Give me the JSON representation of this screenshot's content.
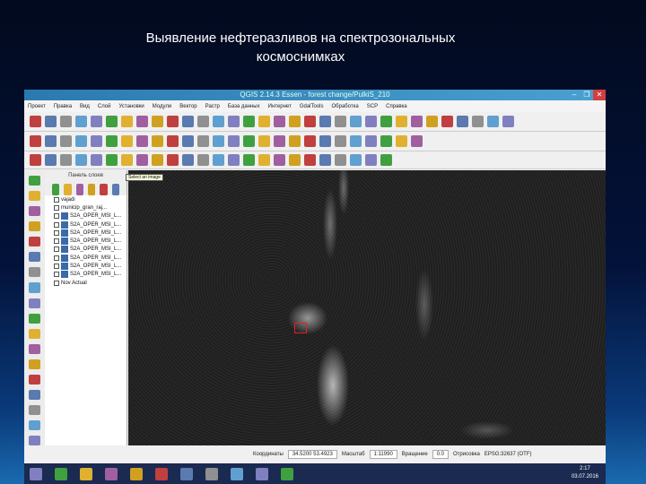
{
  "slide": {
    "title_line1": "Выявление нефтеразливов на спектрозональных",
    "title_line2": "космоснимках"
  },
  "window": {
    "title": "QGIS 2.14.3 Essen - forest change/PulkiS_210",
    "controls": [
      "–",
      "❐",
      "✕"
    ]
  },
  "menu": [
    "Проект",
    "Правка",
    "Вид",
    "Слой",
    "Установки",
    "Модули",
    "Вектор",
    "Растр",
    "База данных",
    "Интернет",
    "GdalTools",
    "Обработка",
    "SCP",
    "Справка"
  ],
  "layers_panel": {
    "header": "Панель слоев",
    "layers": [
      "vajadi",
      "municip_gran_raj...",
      "S2A_OPER_MSI_L...",
      "S2A_OPER_MSI_L...",
      "S2A_OPER_MSI_L...",
      "S2A_OPER_MSI_L...",
      "S2A_OPER_MSI_L...",
      "S2A_OPER_MSI_L...",
      "S2A_OPER_MSI_L...",
      "S2A_OPER_MSI_L...",
      "Nov Actual"
    ]
  },
  "tooltip": "Select an image",
  "status": {
    "coords_label": "Координаты",
    "coords": "34.5200 53.4923",
    "scale_label": "Масштаб",
    "scale": "1:11990",
    "rotation_label": "Вращение",
    "rotation": "0.0",
    "render_label": "Отрисовка",
    "crs": "EPSG:32637 (OTF)"
  },
  "taskbar": {
    "time": "2:17",
    "date": "03.07.2016"
  },
  "colors": {
    "accent": "#2a7ab0",
    "marker": "#e02020"
  }
}
